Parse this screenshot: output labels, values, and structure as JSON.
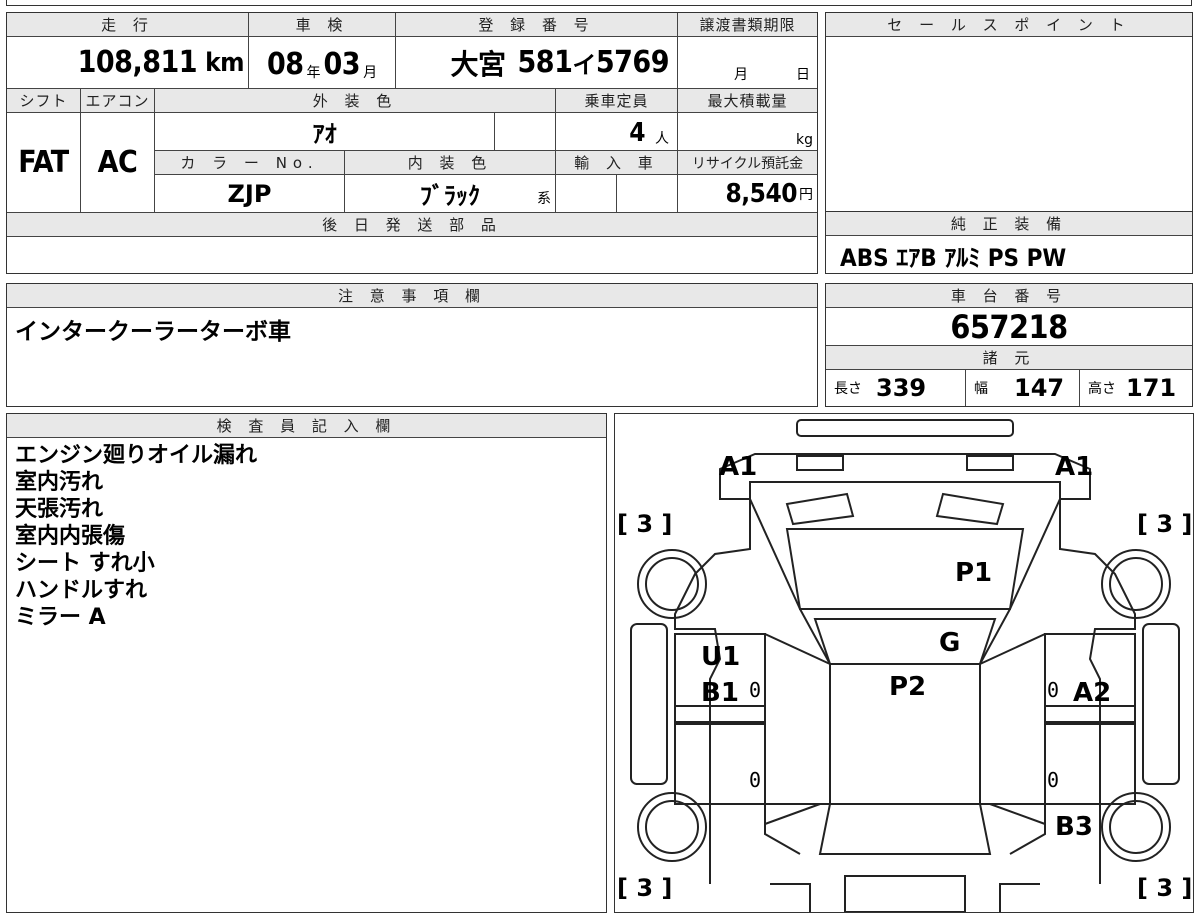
{
  "top_row": {
    "mileage_header": "走 行",
    "mileage_value": "108,811",
    "mileage_unit": "km",
    "inspection_header": "車 検",
    "inspection_year": "08",
    "inspection_year_unit": "年",
    "inspection_month": "03",
    "inspection_month_unit": "月",
    "registration_header": "登 録 番 号",
    "registration_area": "大宮",
    "registration_class": "581",
    "registration_kana": "イ",
    "registration_number": "5769",
    "transfer_header": "譲渡書類期限",
    "transfer_month": "月",
    "transfer_day": "日"
  },
  "second_row": {
    "shift_header": "シフト",
    "shift_value": "FAT",
    "ac_header": "エアコン",
    "ac_value": "AC",
    "exterior_color_header": "外 装 色",
    "exterior_color_value": "ｱｵ",
    "capacity_header": "乗車定員",
    "capacity_value": "4",
    "capacity_unit": "人",
    "max_load_header": "最大積載量",
    "max_load_unit": "kg",
    "color_no_header": "カ ラ ー No.",
    "color_no_value": "ZJP",
    "interior_color_header": "内 装 色",
    "interior_color_value": "ﾌﾞﾗｯｸ",
    "interior_color_suffix": "系",
    "import_header": "輸 入 車",
    "recycle_header": "リサイクル預託金",
    "recycle_value": "8,540",
    "recycle_unit": "円"
  },
  "later_parts": {
    "header": "後 日 発 送 部 品"
  },
  "sales_points": {
    "header": "セ ー ル ス ポ イ ン ト"
  },
  "standard_equipment": {
    "header": "純 正 装 備",
    "value": "ABS ｴｱB ｱﾙﾐ PS PW"
  },
  "notes": {
    "header": "注 意 事 項 欄",
    "value": "インタークーラーターボ車"
  },
  "chassis": {
    "header": "車 台 番 号",
    "value": "657218",
    "specs_header": "諸 元",
    "length_label": "長さ",
    "length_value": "339",
    "width_label": "幅",
    "width_value": "147",
    "height_label": "高さ",
    "height_value": "171"
  },
  "inspector": {
    "header": "検 査 員 記 入 欄",
    "lines": [
      "エンジン廻りオイル漏れ",
      "室内汚れ",
      "天張汚れ",
      "室内内張傷",
      "シート すれ小",
      "ハンドルすれ",
      "ミラー A"
    ]
  },
  "diagram": {
    "marks": {
      "a1_left": "A1",
      "a1_right": "A1",
      "p1": "P1",
      "g": "G",
      "u1": "U1",
      "b1": "B1",
      "p2": "P2",
      "a2": "A2",
      "b3": "B3"
    },
    "tire_fl": "[ 3 ]",
    "tire_fr": "[ 3 ]",
    "tire_rl": "[ 3 ]",
    "tire_rr": "[ 3 ]",
    "zero": "0"
  }
}
